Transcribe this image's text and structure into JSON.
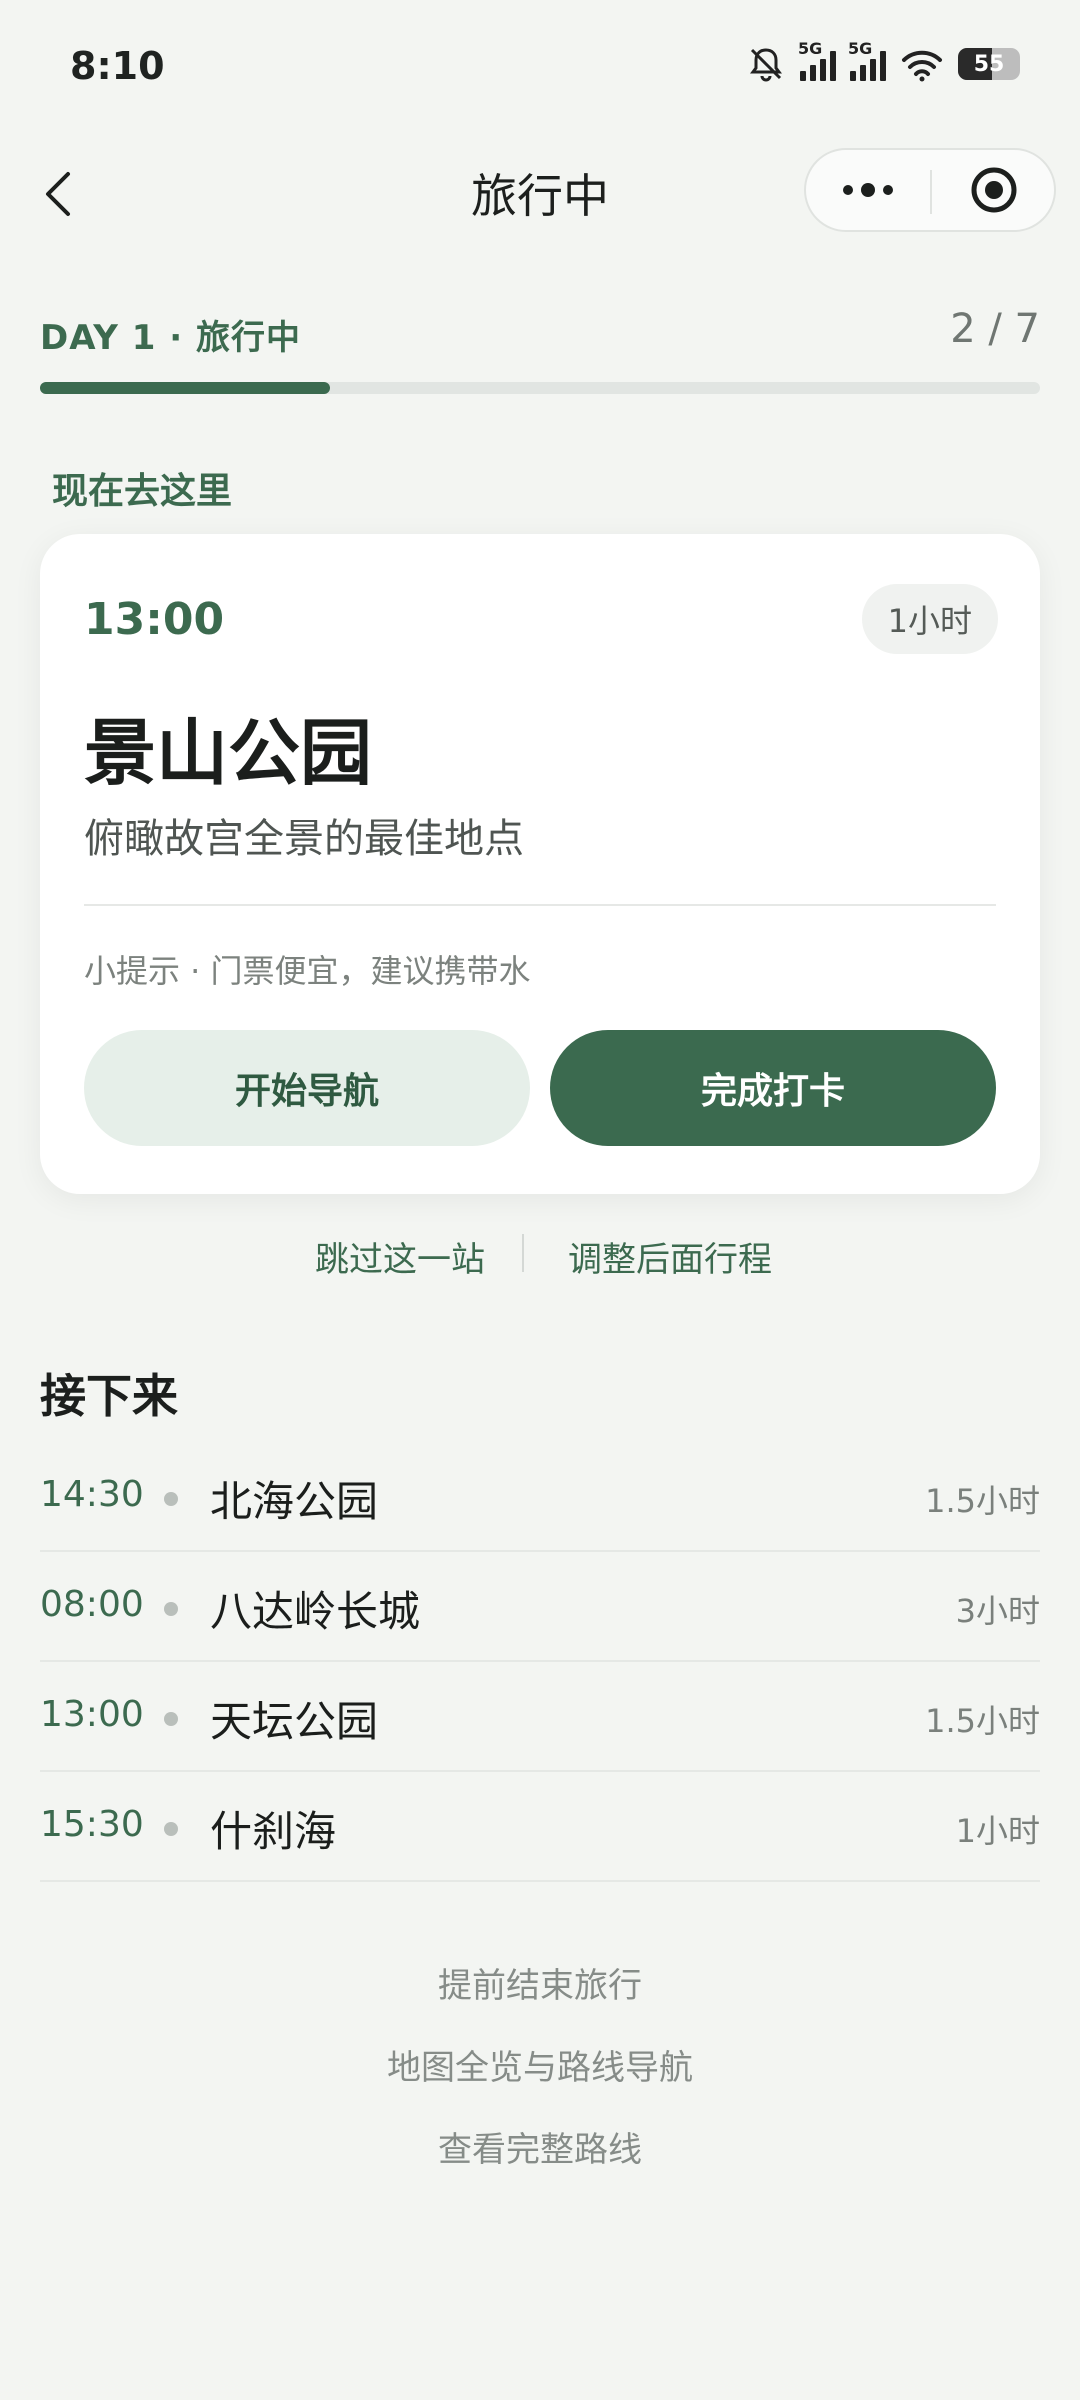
{
  "status_bar": {
    "time": "8:10",
    "network_1": "5G",
    "network_2": "5G",
    "battery": "55",
    "icons": [
      "mute-bell-icon",
      "signal-5g-icon",
      "signal-5g-icon",
      "wifi-icon",
      "battery-icon"
    ]
  },
  "nav": {
    "title": "旅行中",
    "icons": [
      "back-chevron-icon",
      "more-dots-icon",
      "target-close-icon"
    ]
  },
  "progress": {
    "day_label": "DAY 1 · 旅行中",
    "count": "2 / 7",
    "fraction": 0.29
  },
  "current": {
    "section_label": "现在去这里",
    "time": "13:00",
    "duration": "1小时",
    "name": "景山公园",
    "description": "俯瞰故宫全景的最佳地点",
    "tip": "小提示 · 门票便宜，建议携带水",
    "nav_button": "开始导航",
    "checkin_button": "完成打卡"
  },
  "actions": {
    "skip": "跳过这一站",
    "adjust": "调整后面行程"
  },
  "next": {
    "title": "接下来",
    "items": [
      {
        "time": "14:30",
        "name": "北海公园",
        "duration": "1.5小时"
      },
      {
        "time": "08:00",
        "name": "八达岭长城",
        "duration": "3小时"
      },
      {
        "time": "13:00",
        "name": "天坛公园",
        "duration": "1.5小时"
      },
      {
        "time": "15:30",
        "name": "什刹海",
        "duration": "1小时"
      }
    ]
  },
  "footer": {
    "end_trip": "提前结束旅行",
    "map_overview": "地图全览与路线导航",
    "full_route": "查看完整路线"
  },
  "colors": {
    "accent": "#3b6a4f",
    "accent_light": "#e6efe9",
    "background": "#f3f5f2"
  }
}
